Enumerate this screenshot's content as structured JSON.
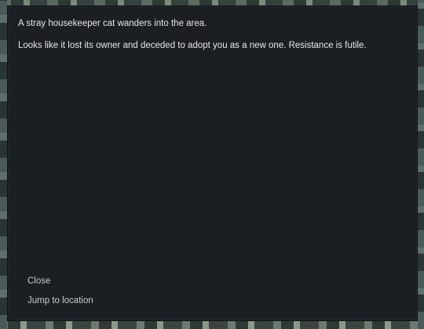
{
  "event": {
    "lines": [
      "A stray housekeeper cat wanders into the area.",
      "Looks like it lost its owner and deceded to adopt you as a new one. Resistance is futile."
    ]
  },
  "options": [
    "Close",
    "Jump to location"
  ]
}
